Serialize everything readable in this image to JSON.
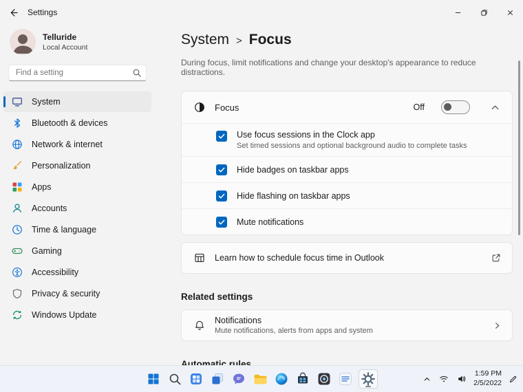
{
  "titlebar": {
    "title": "Settings",
    "controls": [
      "minimize-icon",
      "restore-icon",
      "close-icon"
    ]
  },
  "sidebar": {
    "user": {
      "name": "Telluride",
      "type": "Local Account"
    },
    "search_placeholder": "Find a setting",
    "items": [
      {
        "label": "System",
        "icon": "monitor-icon",
        "selected": true
      },
      {
        "label": "Bluetooth & devices",
        "icon": "bluetooth-icon"
      },
      {
        "label": "Network & internet",
        "icon": "globe-icon"
      },
      {
        "label": "Personalization",
        "icon": "brush-icon"
      },
      {
        "label": "Apps",
        "icon": "apps-grid-icon"
      },
      {
        "label": "Accounts",
        "icon": "person-icon"
      },
      {
        "label": "Time & language",
        "icon": "clock-icon"
      },
      {
        "label": "Gaming",
        "icon": "controller-icon"
      },
      {
        "label": "Accessibility",
        "icon": "accessibility-icon"
      },
      {
        "label": "Privacy & security",
        "icon": "shield-icon"
      },
      {
        "label": "Windows Update",
        "icon": "update-arrows-icon"
      }
    ]
  },
  "main": {
    "breadcrumb": {
      "root": "System",
      "sep": ">",
      "current": "Focus"
    },
    "description": "During focus, limit notifications and change your desktop's appearance to reduce distractions.",
    "focus": {
      "title": "Focus",
      "icon": "focus-moon-icon",
      "state": "Off",
      "options": [
        {
          "label": "Use focus sessions in the Clock app",
          "sublabel": "Set timed sessions and optional background audio to complete tasks",
          "checked": true
        },
        {
          "label": "Hide badges on taskbar apps",
          "checked": true
        },
        {
          "label": "Hide flashing on taskbar apps",
          "checked": true
        },
        {
          "label": "Mute notifications",
          "checked": true
        }
      ]
    },
    "outlook_link": {
      "label": "Learn how to schedule focus time in Outlook",
      "icon": "schedule-grid-icon",
      "trailing_icon": "external-link-icon"
    },
    "related": {
      "heading": "Related settings",
      "notifications": {
        "title": "Notifications",
        "subtitle": "Mute notifications, alerts from apps and system",
        "icon": "bell-icon"
      }
    },
    "automatic_rules_heading": "Automatic rules"
  },
  "taskbar": {
    "pinned": [
      "start-icon",
      "search-icon",
      "widgets-icon",
      "task-view-icon",
      "chat-icon",
      "file-explorer-icon",
      "edge-icon",
      "store-icon",
      "photos-icon",
      "list-app-icon",
      "settings-gear-icon"
    ],
    "active_app": "settings-gear-icon",
    "tray_icons": [
      "chevron-up-icon",
      "wifi-icon",
      "speaker-icon",
      "pen-icon"
    ],
    "time": "1:59 PM",
    "date": "2/5/2022"
  },
  "colors": {
    "accent": "#0067c0",
    "card_bg": "#fbfbfb",
    "window_bg": "#f3f3f3",
    "taskbar_bg": "#eff3f9"
  }
}
